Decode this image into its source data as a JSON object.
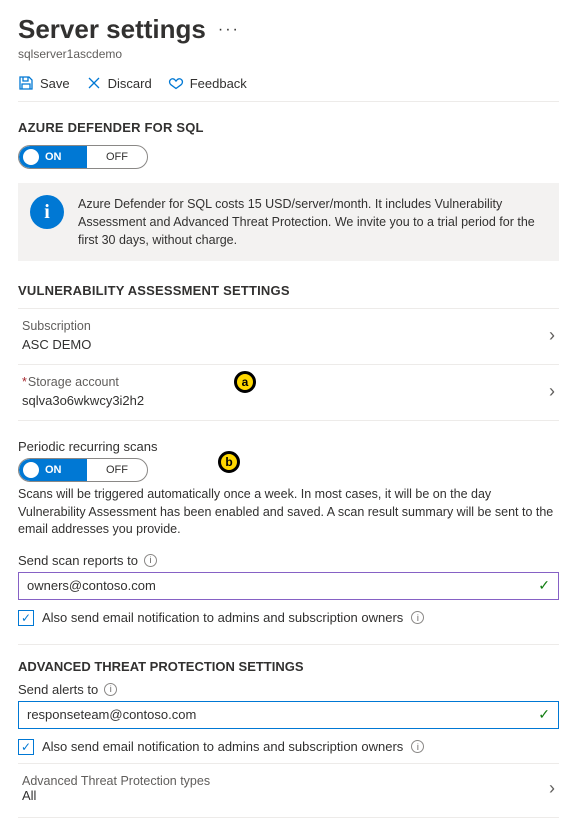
{
  "header": {
    "title": "Server settings",
    "subtitle": "sqlserver1ascdemo"
  },
  "toolbar": {
    "save": "Save",
    "discard": "Discard",
    "feedback": "Feedback"
  },
  "defender": {
    "heading": "AZURE DEFENDER FOR SQL",
    "toggle_on": "ON",
    "toggle_off": "OFF",
    "info": "Azure Defender for SQL costs 15 USD/server/month. It includes Vulnerability Assessment and Advanced Threat Protection. We invite you to a trial period for the first 30 days, without charge."
  },
  "va": {
    "heading": "VULNERABILITY ASSESSMENT SETTINGS",
    "subscription_label": "Subscription",
    "subscription_value": "ASC DEMO",
    "storage_label": "Storage account",
    "storage_value": "sqlva3o6wkwcy3i2h2",
    "periodic_label": "Periodic recurring scans",
    "toggle_on": "ON",
    "toggle_off": "OFF",
    "periodic_desc": "Scans will be triggered automatically once a week. In most cases, it will be on the day Vulnerability Assessment has been enabled and saved. A scan result summary will be sent to the email addresses you provide.",
    "send_reports_label": "Send scan reports to",
    "send_reports_value": "owners@contoso.com",
    "also_email": "Also send email notification to admins and subscription owners"
  },
  "atp": {
    "heading": "ADVANCED THREAT PROTECTION SETTINGS",
    "send_alerts_label": "Send alerts to",
    "send_alerts_value": "responseteam@contoso.com",
    "also_email": "Also send email notification to admins and subscription owners",
    "types_label": "Advanced Threat Protection types",
    "types_value": "All"
  },
  "markers": {
    "a": "a",
    "b": "b"
  }
}
